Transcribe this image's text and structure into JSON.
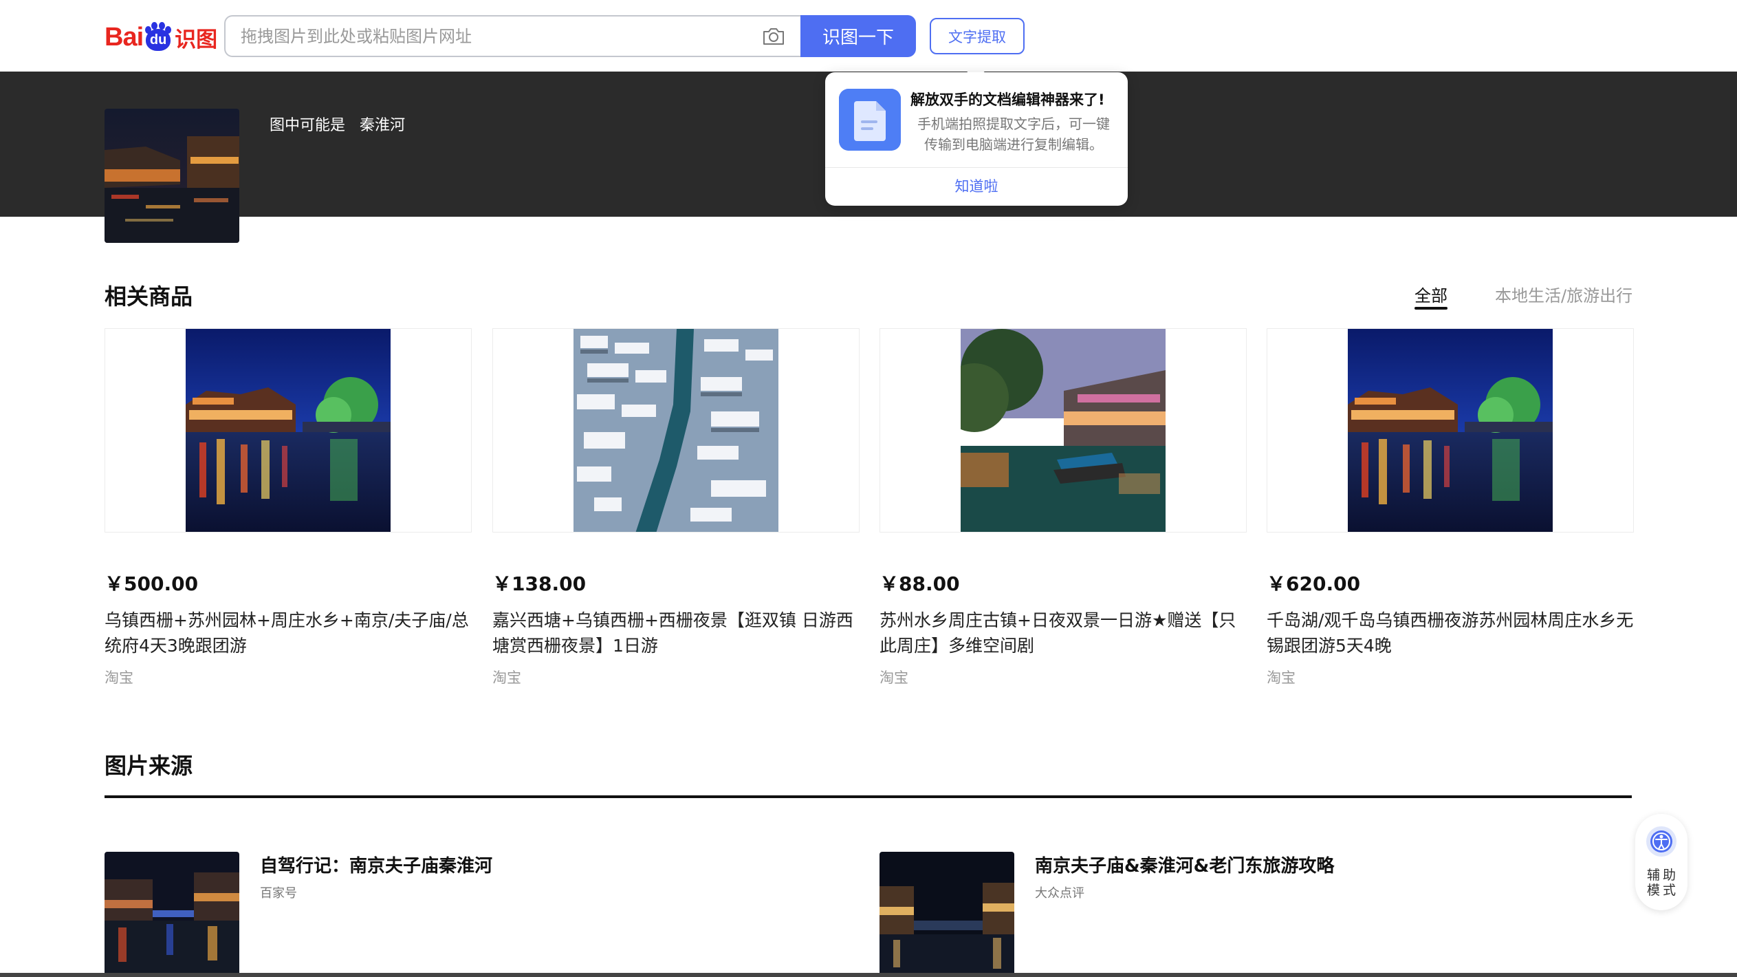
{
  "header": {
    "logo": {
      "bai": "Bai",
      "du": "du",
      "shitu": "识图"
    },
    "search": {
      "placeholder": "拖拽图片到此处或粘贴图片网址",
      "value": ""
    },
    "search_button": "识图一下",
    "ocr_button": "文字提取"
  },
  "result": {
    "prefix": "图中可能是",
    "place": "秦淮河"
  },
  "popover": {
    "title": "解放双手的文档编辑神器来了!",
    "line1": "手机端拍照提取文字后，可一键",
    "line2": "传输到电脑端进行复制编辑。",
    "ok": "知道啦"
  },
  "products_section": {
    "title": "相关商品",
    "tabs": [
      {
        "label": "全部",
        "active": true
      },
      {
        "label": "本地生活/旅游出行",
        "active": false
      }
    ],
    "items": [
      {
        "price": "￥500.00",
        "title": "乌镇西栅+苏州园林+周庄水乡+南京/夫子庙/总统府4天3晚跟团游",
        "source": "淘宝"
      },
      {
        "price": "￥138.00",
        "title": "嘉兴西塘+乌镇西栅+西栅夜景【逛双镇 日游西塘赏西栅夜景】1日游",
        "source": "淘宝"
      },
      {
        "price": "￥88.00",
        "title": "苏州水乡周庄古镇+日夜双景一日游★赠送【只此周庄】多维空间剧",
        "source": "淘宝"
      },
      {
        "price": "￥620.00",
        "title": "千岛湖/观千岛乌镇西栅夜游苏州园林周庄水乡无锡跟团游5天4晚",
        "source": "淘宝"
      }
    ]
  },
  "sources_section": {
    "title": "图片来源",
    "items": [
      {
        "title": "自驾行记：南京夫子庙秦淮河",
        "site": "百家号"
      },
      {
        "title": "南京夫子庙&秦淮河&老门东旅游攻略",
        "site": "大众点评"
      }
    ]
  },
  "assist": {
    "line1": "辅助",
    "line2": "模式"
  },
  "colors": {
    "brand_blue": "#4e6ef2",
    "brand_red": "#e8261f",
    "band": "#2b2b2b"
  }
}
